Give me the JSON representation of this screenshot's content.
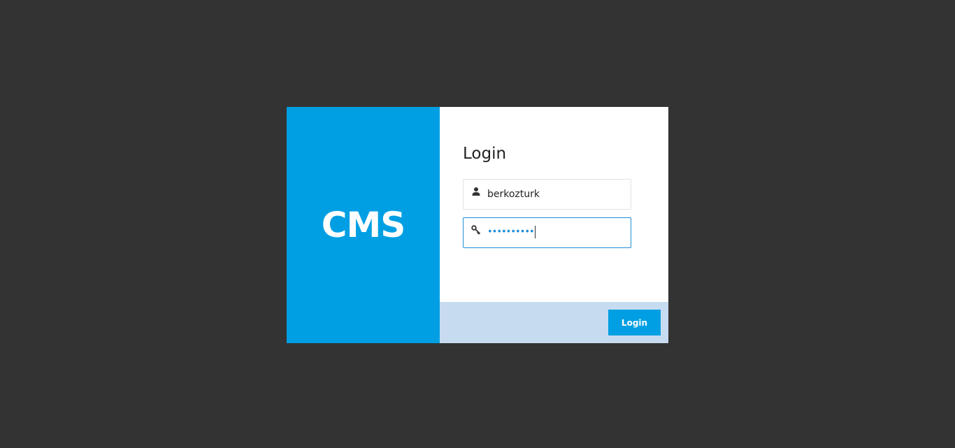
{
  "brand": {
    "logo_text": "CMS",
    "color": "#009fe3"
  },
  "form": {
    "title": "Login",
    "username": {
      "icon": "user-icon",
      "value": "berkozturk"
    },
    "password": {
      "icon": "key-icon",
      "masked_value": "••••••••••"
    },
    "submit_label": "Login"
  },
  "colors": {
    "background": "#333333",
    "accent": "#009fe3",
    "footer": "#c7dbf0",
    "focus_border": "#1c8fd6"
  }
}
